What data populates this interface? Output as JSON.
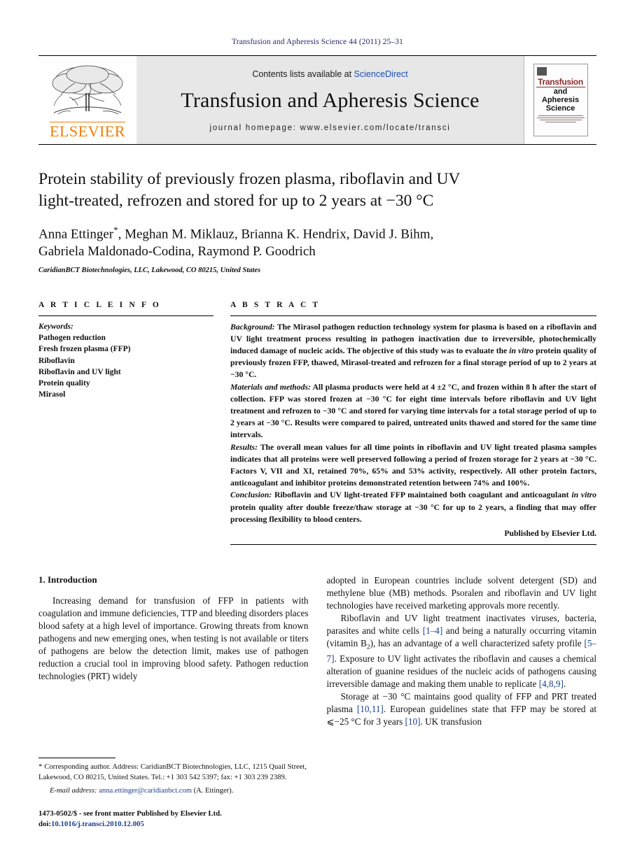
{
  "running_head": "Transfusion and Apheresis Science 44 (2011) 25–31",
  "masthead": {
    "publisher_logo_text": "ELSEVIER",
    "contents_prefix": "Contents lists available at ",
    "contents_link": "ScienceDirect",
    "journal_title": "Transfusion and Apheresis Science",
    "homepage": "journal homepage: www.elsevier.com/locate/transci",
    "cover": {
      "line1": "Transfusion",
      "line2": "and Apheresis",
      "line3": "Science"
    }
  },
  "article": {
    "title": "Protein stability of previously frozen plasma, riboflavin and UV light-treated, refrozen and stored for up to 2 years at −30 °C",
    "title_line1": "Protein stability of previously frozen plasma, riboflavin and UV",
    "title_line2": "light-treated, refrozen and stored for up to 2 years at −30 °C",
    "authors_line1": "Anna Ettinger",
    "corresponding_marker": "*",
    "authors_line1_rest": ", Meghan M. Miklauz, Brianna K. Hendrix, David J. Bihm,",
    "authors_line2": "Gabriela Maldonado-Codina, Raymond P. Goodrich",
    "affiliation": "CaridianBCT Biotechnologies, LLC, Lakewood, CO 80215, United States"
  },
  "article_info": {
    "heading": "A R T I C L E   I N F O",
    "keywords_label": "Keywords:",
    "keywords": [
      "Pathogen reduction",
      "Fresh frozen plasma (FFP)",
      "Riboflavin",
      "Riboflavin and UV light",
      "Protein quality",
      "Mirasol"
    ]
  },
  "abstract": {
    "heading": "A B S T R A C T",
    "background_label": "Background:",
    "background_text": " The Mirasol pathogen reduction technology system for plasma is based on a riboflavin and UV light treatment process resulting in pathogen inactivation due to irreversible, photochemically induced damage of nucleic acids. The objective of this study was to evaluate the ",
    "background_italic": "in vitro",
    "background_text2": " protein quality of previously frozen FFP, thawed, Mirasol-treated and refrozen for a final storage period of up to 2 years at −30 °C.",
    "methods_label": "Materials and methods:",
    "methods_text": " All plasma products were held at 4 ±2 °C, and frozen within 8 h after the start of collection. FFP was stored frozen at −30 °C for eight time intervals before riboflavin and UV light treatment and refrozen to −30 °C and stored for varying time intervals for a total storage period of up to 2 years at −30 °C. Results were compared to paired, untreated units thawed and stored for the same time intervals.",
    "results_label": "Results:",
    "results_text": " The overall mean values for all time points in riboflavin and UV light treated plasma samples indicates that all proteins were well preserved following a period of frozen storage for 2 years at −30 °C. Factors V, VII and XI, retained 70%, 65% and 53% activity, respectively. All other protein factors, anticoagulant and inhibitor proteins demonstrated retention between 74% and 100%.",
    "conclusion_label": "Conclusion:",
    "conclusion_text": " Riboflavin and UV light-treated FFP maintained both coagulant and anticoagulant ",
    "conclusion_italic": "in vitro",
    "conclusion_text2": " protein quality after double freeze/thaw storage at −30 °C for up to 2 years, a finding that may offer processing flexibility to blood centers.",
    "published_by": "Published by Elsevier Ltd."
  },
  "body": {
    "section1_heading": "1. Introduction",
    "left_paragraph_1": "Increasing demand for transfusion of FFP in patients with coagulation and immune deficiencies, TTP and bleeding disorders places blood safety at a high level of importance. Growing threats from known pathogens and new emerging ones, when testing is not available or titers of pathogens are below the detection limit, makes use of pathogen reduction a crucial tool in improving blood safety. Pathogen reduction technologies (PRT) widely",
    "right_paragraph_1_cont": "adopted in European countries include solvent detergent (SD) and methylene blue (MB) methods. Psoralen and riboflavin and UV light technologies have received marketing approvals more recently.",
    "right_paragraph_2_a": "Riboflavin and UV light treatment inactivates viruses, bacteria, parasites and white cells ",
    "right_ref_1": "[1–4]",
    "right_paragraph_2_b": " and being a naturally occurring vitamin (vitamin B",
    "right_sub_2": "2",
    "right_paragraph_2_c": "), has an advantage of a well characterized safety profile ",
    "right_ref_2": "[5–7]",
    "right_paragraph_2_d": ". Exposure to UV light activates the riboflavin and causes a chemical alteration of guanine residues of the nucleic acids of pathogens causing irreversible damage and making them unable to replicate ",
    "right_ref_3": "[4,8,9]",
    "right_paragraph_2_e": ".",
    "right_paragraph_3_a": "Storage at −30 °C maintains good quality of FFP and PRT treated plasma ",
    "right_ref_4": "[10,11]",
    "right_paragraph_3_b": ". European guidelines state that FFP may be stored at ⩽−25 °C for 3 years ",
    "right_ref_5": "[10]",
    "right_paragraph_3_c": ". UK transfusion"
  },
  "footnote": {
    "star": "*",
    "text": " Corresponding author. Address: CaridianBCT Biotechnologies, LLC, 1215 Quail Street, Lakewood, CO 80215, United States. Tel.: +1 303 542 5397; fax: +1 303 239 2389.",
    "email_label": "E-mail address:",
    "email": "anna.ettinger@caridianbct.com",
    "email_suffix": " (A. Ettinger)."
  },
  "imprint": {
    "issn_line": "1473-0502/$ - see front matter Published by Elsevier Ltd.",
    "doi_label": "doi:",
    "doi": "10.1016/j.transci.2010.12.005"
  },
  "colors": {
    "running_head": "#2a2a6e",
    "link": "#1b4eb8",
    "reference": "#1b3f8f",
    "elsevier_orange": "#ef7d00",
    "masthead_bg": "#e7e7e7",
    "cover_red": "#8c2b2b"
  }
}
